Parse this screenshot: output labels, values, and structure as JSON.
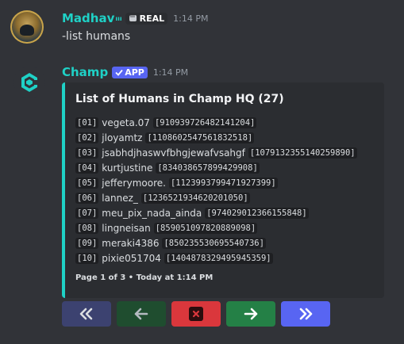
{
  "messages": [
    {
      "author": "Madhav",
      "author_superscript": "ııı",
      "badge_label": "REAL",
      "time": "1:14 PM",
      "content": "-list humans"
    },
    {
      "author": "Champ",
      "badge_label": "APP",
      "time": "1:14 PM",
      "embed": {
        "title": "List of Humans in Champ HQ (27)",
        "accent_color": "#1fd1c6",
        "rows": [
          {
            "index": "[01]",
            "name": "vegeta.07",
            "id": "[910939726482141204]"
          },
          {
            "index": "[02]",
            "name": "jloyamtz",
            "id": "[1108602547561832518]"
          },
          {
            "index": "[03]",
            "name": "jsabhdjhaswvfbhgjewafvsahgf",
            "id": "[1079132355140259890]"
          },
          {
            "index": "[04]",
            "name": "kurtjustine",
            "id": "[834038657899429908]"
          },
          {
            "index": "[05]",
            "name": "jefferymoore.",
            "id": "[1123993799471927399]"
          },
          {
            "index": "[06]",
            "name": "lannez_",
            "id": "[1236521934620201050]"
          },
          {
            "index": "[07]",
            "name": "meu_pix_nada_ainda",
            "id": "[974029012366155848]"
          },
          {
            "index": "[08]",
            "name": "lingneisan",
            "id": "[859051097820889098]"
          },
          {
            "index": "[09]",
            "name": "meraki4386",
            "id": "[850235530695540736]"
          },
          {
            "index": "[10]",
            "name": "pixie051704",
            "id": "[1404878329495945359]"
          }
        ],
        "footer": "Page 1 of 3 • Today at 1:14 PM"
      },
      "buttons": [
        {
          "icon": "double-chevron-left-icon"
        },
        {
          "icon": "arrow-left-icon"
        },
        {
          "icon": "close-icon"
        },
        {
          "icon": "arrow-right-icon"
        },
        {
          "icon": "double-chevron-right-icon"
        }
      ]
    }
  ]
}
